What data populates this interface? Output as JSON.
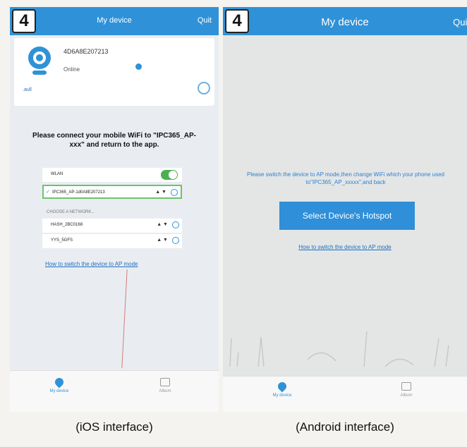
{
  "ios": {
    "step": "4",
    "title": "My device",
    "quit": "Quit",
    "device": {
      "id": "4D6A8E207213",
      "status": "Online",
      "signal_text": ".aull"
    },
    "instruction": "Please connect your mobile WiFi to \"IPC365_AP-xxx\" and return to the app.",
    "wifi": {
      "header_label": "WLAN",
      "current_network": "IPC365_AP-1d0A8E207213",
      "choose_label": "CHOOSE A NETWORK...",
      "networks": [
        "HASH_2BC0168",
        "YYS_5GFS"
      ]
    },
    "link": "How to switch the device to AP mode",
    "tabs": {
      "device": "My device",
      "album": "Album"
    },
    "caption": "(iOS interface)"
  },
  "android": {
    "step": "4",
    "title": "My device",
    "quit": "Quit",
    "instruction": "Please switch the device to AP mode,then change WiFi which your phone used to\"IPC365_AP_xxxxx\",and back",
    "button": "Select Device's Hotspot",
    "link": "How to switch the device to AP mode",
    "tabs": {
      "device": "My device",
      "album": "Album"
    },
    "caption": "(Android interface)"
  },
  "colors": {
    "accent": "#2f92d8",
    "toggle_on": "#4caf50"
  },
  "icons": [
    "camera-icon",
    "gear-icon",
    "info-icon",
    "location-pin-icon",
    "album-icon"
  ]
}
